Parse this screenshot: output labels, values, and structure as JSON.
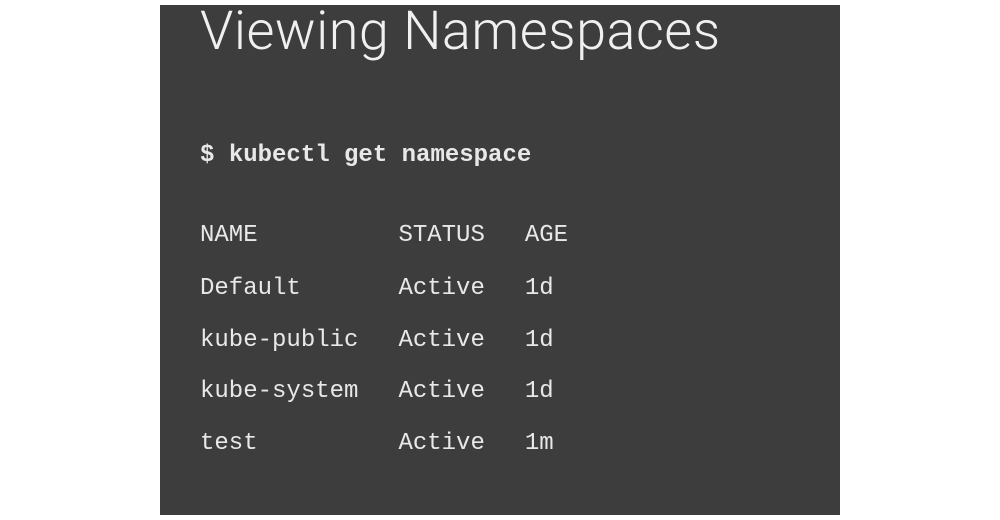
{
  "title": "Viewing Namespaces",
  "prompt": "$",
  "command": "kubectl get namespace",
  "table": {
    "headers": [
      "NAME",
      "STATUS",
      "AGE"
    ],
    "rows": [
      {
        "name": "Default",
        "status": "Active",
        "age": "1d"
      },
      {
        "name": "kube-public",
        "status": "Active",
        "age": "1d"
      },
      {
        "name": "kube-system",
        "status": "Active",
        "age": "1d"
      },
      {
        "name": "test",
        "status": "Active",
        "age": "1m"
      }
    ]
  }
}
